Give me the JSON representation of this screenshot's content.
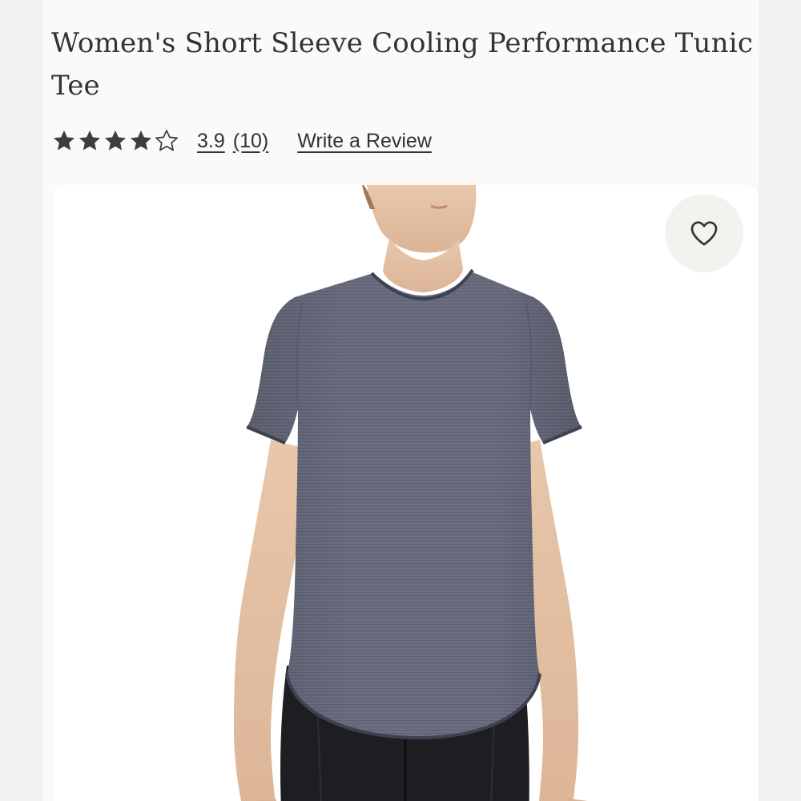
{
  "product": {
    "title": "Women's Short Sleeve Cooling Performance Tunic Tee",
    "image_alt": "Model wearing gray short sleeve tunic tee"
  },
  "rating": {
    "value": "3.9",
    "count": "(10)",
    "stars_filled": 4,
    "stars_total": 5,
    "write_review_label": "Write a Review"
  },
  "icons": {
    "star_filled": "star-filled-icon",
    "star_empty": "star-outline-icon",
    "favorite": "heart-outline-icon"
  },
  "colors": {
    "page_background": "#fbfaf8",
    "outer_background": "#f3f1ef",
    "text": "#333333",
    "star": "#3d3d3d",
    "shirt": "#6b6f80"
  }
}
